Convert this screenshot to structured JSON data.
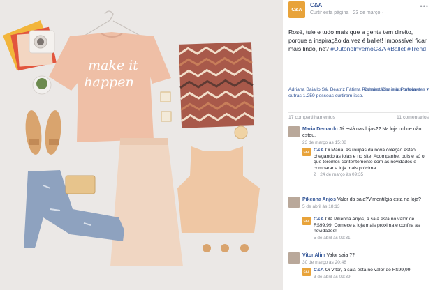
{
  "post": {
    "page_name": "C&A",
    "meta": "Curtir esta página · 23 de março ·",
    "text": "Rosé, tule e tudo mais que a gente tem direito, porque a inspiração da vez é ballet! Impossível ficar mais lindo, né?",
    "tags": "#OutonoInvernoC&A #Ballet #Trend",
    "shirt_print": [
      "make it",
      "happen"
    ],
    "likes": "Adriana Baiallo Sá, Beatriz Fátima Pinheiro, Danielle Portela e outras 1.259 pessoas curtiram isso.",
    "sort_label": "Comentários mais relevantes ▾",
    "shares": "17 compartilhamentos",
    "comments_count": "11 comentários"
  },
  "comments": [
    {
      "name": "Maria Demardo",
      "text": "Já está nas lojas?? Na loja online não estou.",
      "time": "23 de março às 15:08",
      "reply": {
        "name": "C&A",
        "text": "Oi Maria, as roupas da nova coleção estão chegando às lojas e no site. Acompanhe, pois é só o que teremos contentemente com as novidades e comparar a loja mais próxima.",
        "time": "2 · 24 de março às 09:35"
      }
    },
    {
      "name": "Pikenna Anjos",
      "text": "Valor da saia?Vimentilgia esta na loja?",
      "time": "5 de abril às 18:13",
      "reply": {
        "name": "C&A",
        "text": "Olá Pikenna Anjos, a saia está no valor de R$99,99. Comece a loja mais próxima e confira as novidades!",
        "time": "5 de abril às 09:31"
      }
    },
    {
      "name": "Vitor Alim",
      "text": "Valor saia ??",
      "time": "30 de março às 20:48",
      "reply": {
        "name": "C&A",
        "text": "Oi Vitor, a saia está no valor de R$99,99",
        "time": "3 de abril às 09:39"
      }
    }
  ]
}
